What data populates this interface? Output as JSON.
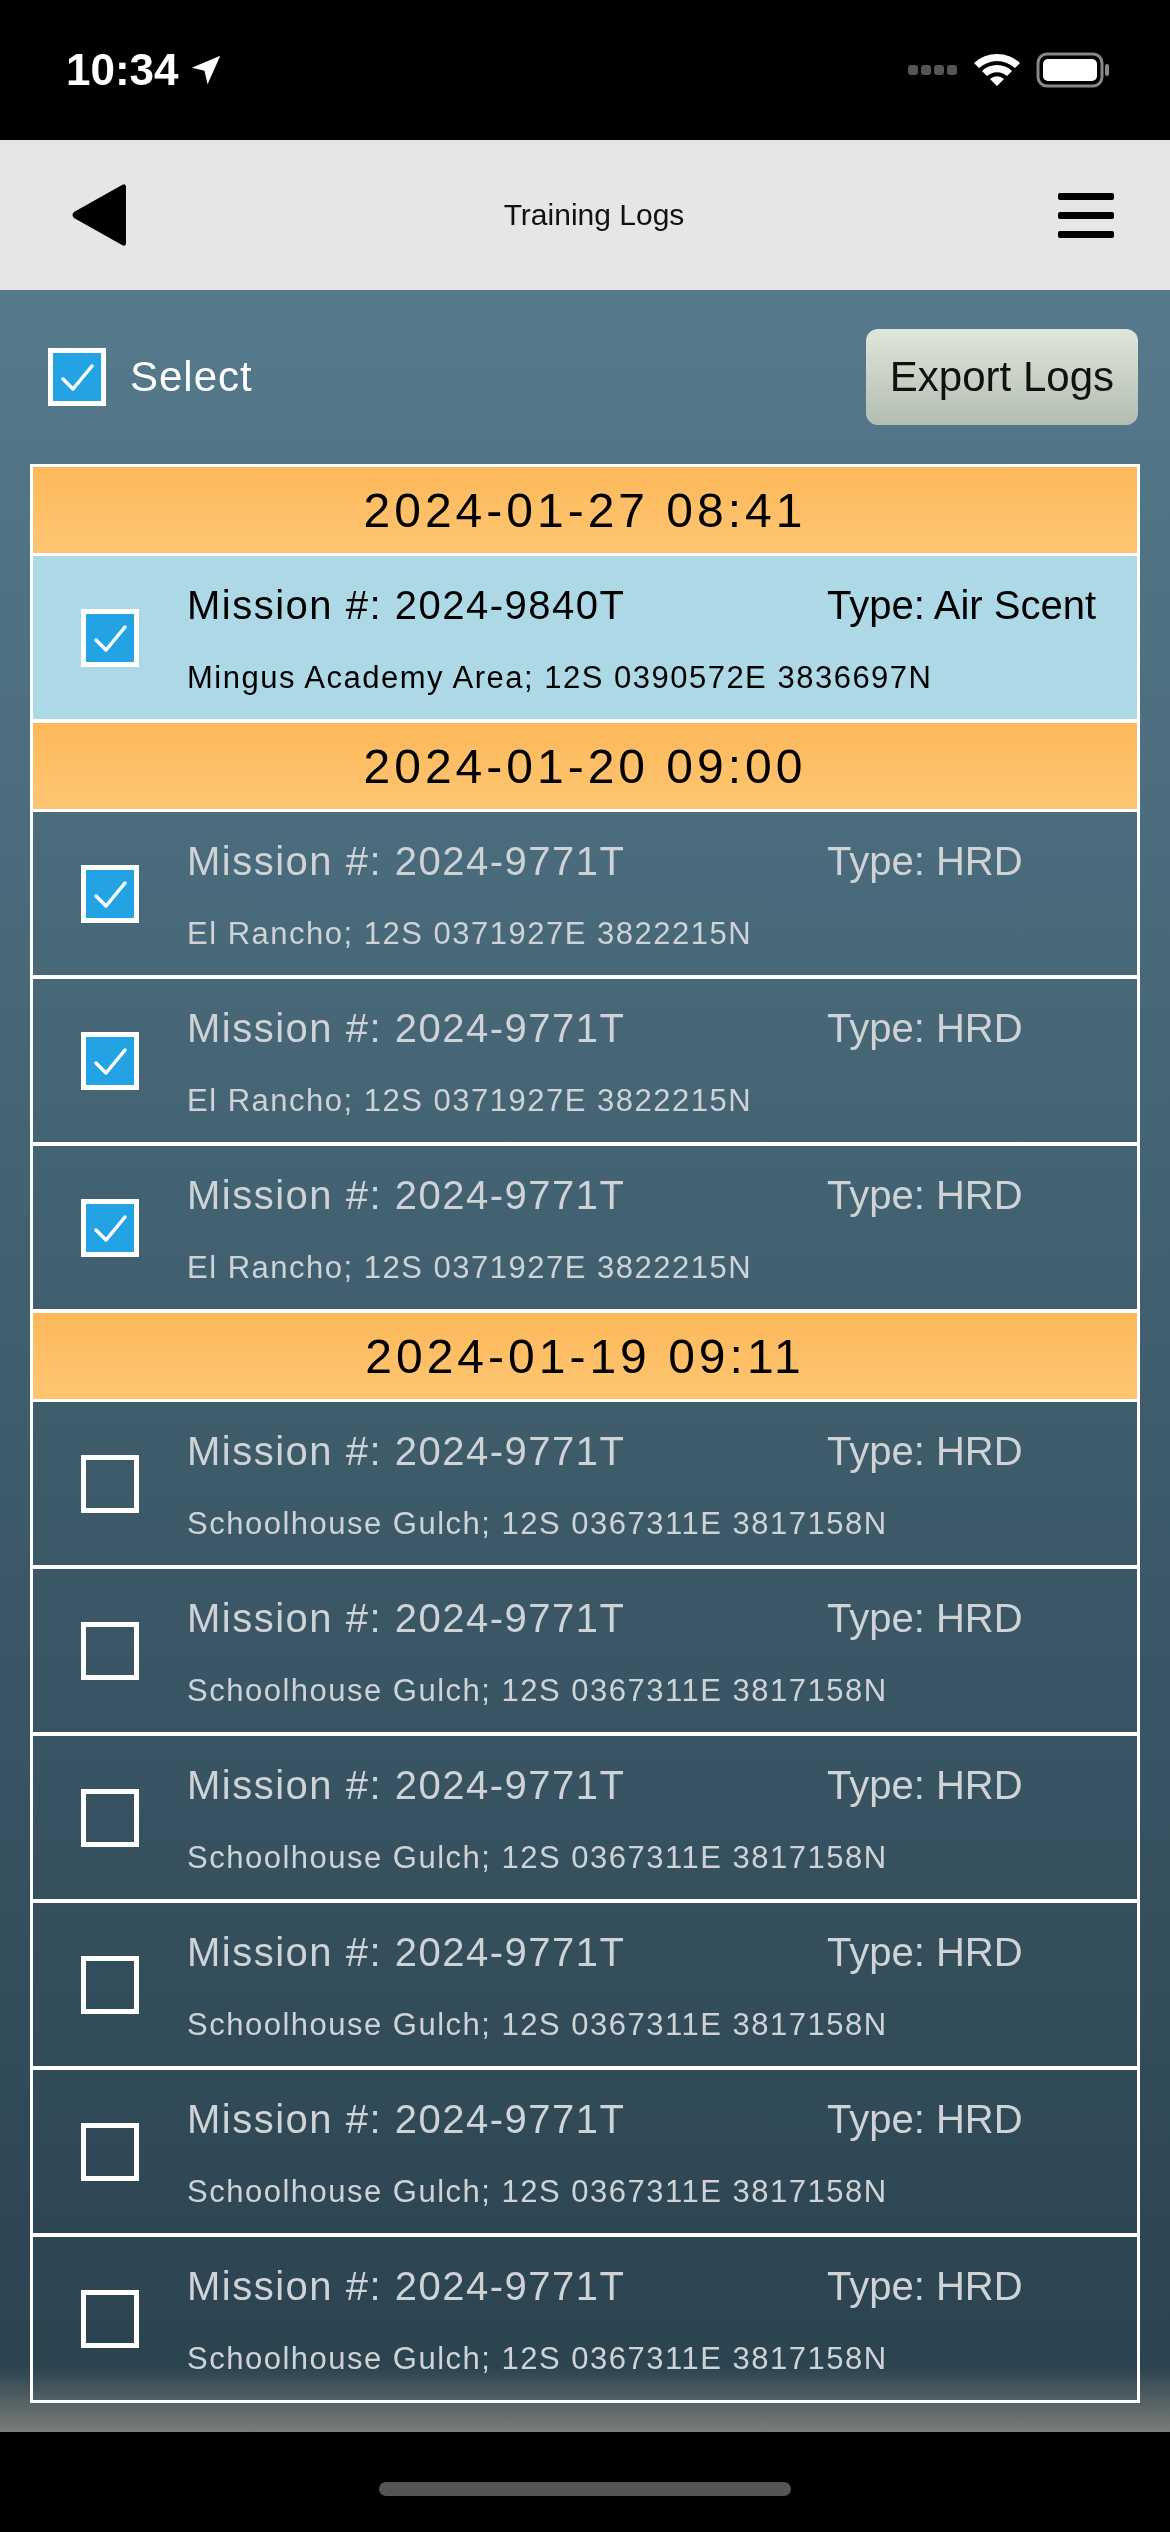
{
  "status_bar": {
    "time": "10:34"
  },
  "nav_bar": {
    "title": "Training Logs"
  },
  "toolbar": {
    "select": {
      "label": "Select",
      "checked": true
    },
    "export_button": "Export Logs"
  },
  "groups": [
    {
      "date": "2024-01-27 08:41",
      "logs": [
        {
          "mission": "Mission #: 2024-9840T",
          "type": "Type: Air Scent",
          "location": "Mingus Academy Area; 12S 0390572E 3836697N",
          "checked": true,
          "selected": true
        }
      ]
    },
    {
      "date": "2024-01-20 09:00",
      "logs": [
        {
          "mission": "Mission #: 2024-9771T",
          "type": "Type: HRD",
          "location": "El Rancho; 12S 0371927E 3822215N",
          "checked": true,
          "selected": false
        },
        {
          "mission": "Mission #: 2024-9771T",
          "type": "Type: HRD",
          "location": "El Rancho; 12S 0371927E 3822215N",
          "checked": true,
          "selected": false
        },
        {
          "mission": "Mission #: 2024-9771T",
          "type": "Type: HRD",
          "location": "El Rancho; 12S 0371927E 3822215N",
          "checked": true,
          "selected": false
        }
      ]
    },
    {
      "date": "2024-01-19 09:11",
      "logs": [
        {
          "mission": "Mission #: 2024-9771T",
          "type": "Type: HRD",
          "location": "Schoolhouse Gulch; 12S 0367311E 3817158N",
          "checked": false,
          "selected": false
        },
        {
          "mission": "Mission #: 2024-9771T",
          "type": "Type: HRD",
          "location": "Schoolhouse Gulch; 12S 0367311E 3817158N",
          "checked": false,
          "selected": false
        },
        {
          "mission": "Mission #: 2024-9771T",
          "type": "Type: HRD",
          "location": "Schoolhouse Gulch; 12S 0367311E 3817158N",
          "checked": false,
          "selected": false
        },
        {
          "mission": "Mission #: 2024-9771T",
          "type": "Type: HRD",
          "location": "Schoolhouse Gulch; 12S 0367311E 3817158N",
          "checked": false,
          "selected": false
        },
        {
          "mission": "Mission #: 2024-9771T",
          "type": "Type: HRD",
          "location": "Schoolhouse Gulch; 12S 0367311E 3817158N",
          "checked": false,
          "selected": false
        },
        {
          "mission": "Mission #: 2024-9771T",
          "type": "Type: HRD",
          "location": "Schoolhouse Gulch; 12S 0367311E 3817158N",
          "checked": false,
          "selected": false
        }
      ]
    }
  ]
}
